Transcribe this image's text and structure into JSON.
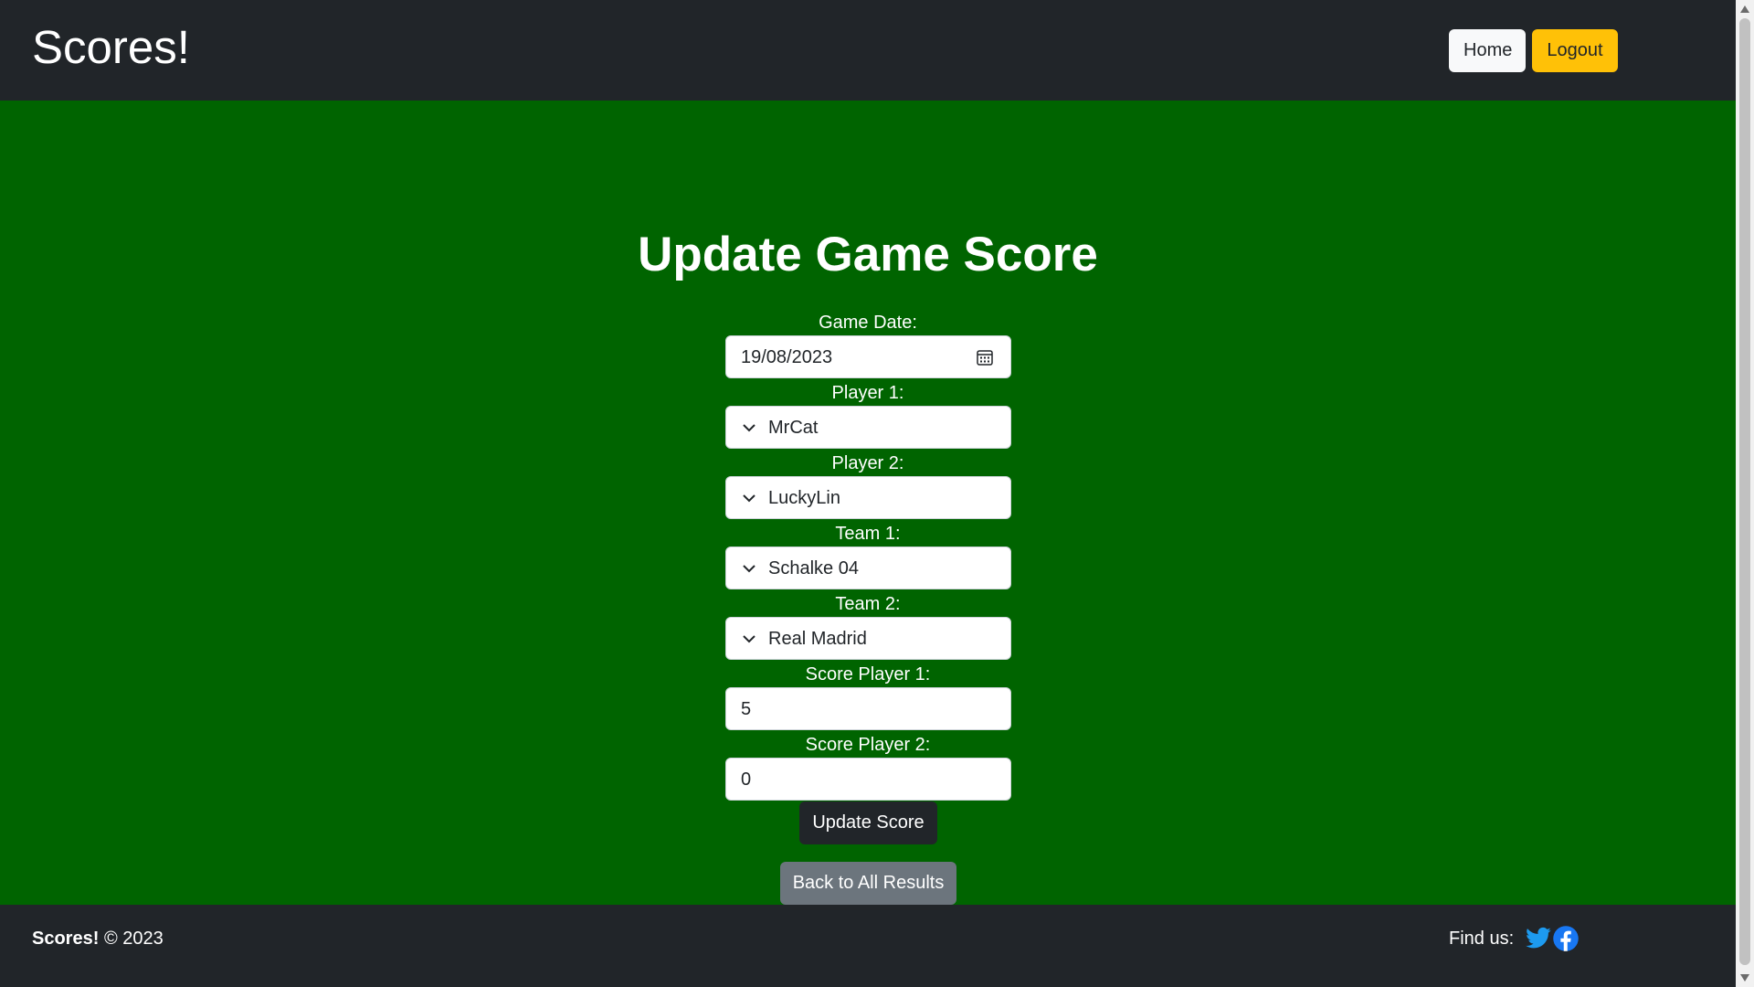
{
  "header": {
    "brand": "Scores!",
    "nav": {
      "home": "Home",
      "logout": "Logout"
    }
  },
  "main": {
    "title": "Update Game Score",
    "form": {
      "game_date": {
        "label": "Game Date:",
        "value": "19/08/2023",
        "icon": "calendar-icon"
      },
      "player1": {
        "label": "Player 1:",
        "value": "MrCat",
        "icon": "chevron-down-icon"
      },
      "player2": {
        "label": "Player 2:",
        "value": "LuckyLin",
        "icon": "chevron-down-icon"
      },
      "team1": {
        "label": "Team 1:",
        "value": "Schalke 04",
        "icon": "chevron-down-icon"
      },
      "team2": {
        "label": "Team 2:",
        "value": "Real Madrid",
        "icon": "chevron-down-icon"
      },
      "score1": {
        "label": "Score Player 1:",
        "value": "5"
      },
      "score2": {
        "label": "Score Player 2:",
        "value": "0"
      },
      "submit": "Update Score"
    },
    "back": "Back to All Results"
  },
  "footer": {
    "brand": "Scores!",
    "copyright": "© 2023",
    "find_us": "Find us:",
    "social": [
      "twitter-icon",
      "facebook-icon"
    ]
  },
  "colors": {
    "header_bg": "#212529",
    "main_bg": "#006400",
    "logout_btn": "#ffc107",
    "home_btn": "#f8f9fa",
    "back_btn": "#6c757d",
    "update_btn": "#212529",
    "twitter": "#1d9bf0",
    "facebook": "#1877f2"
  }
}
